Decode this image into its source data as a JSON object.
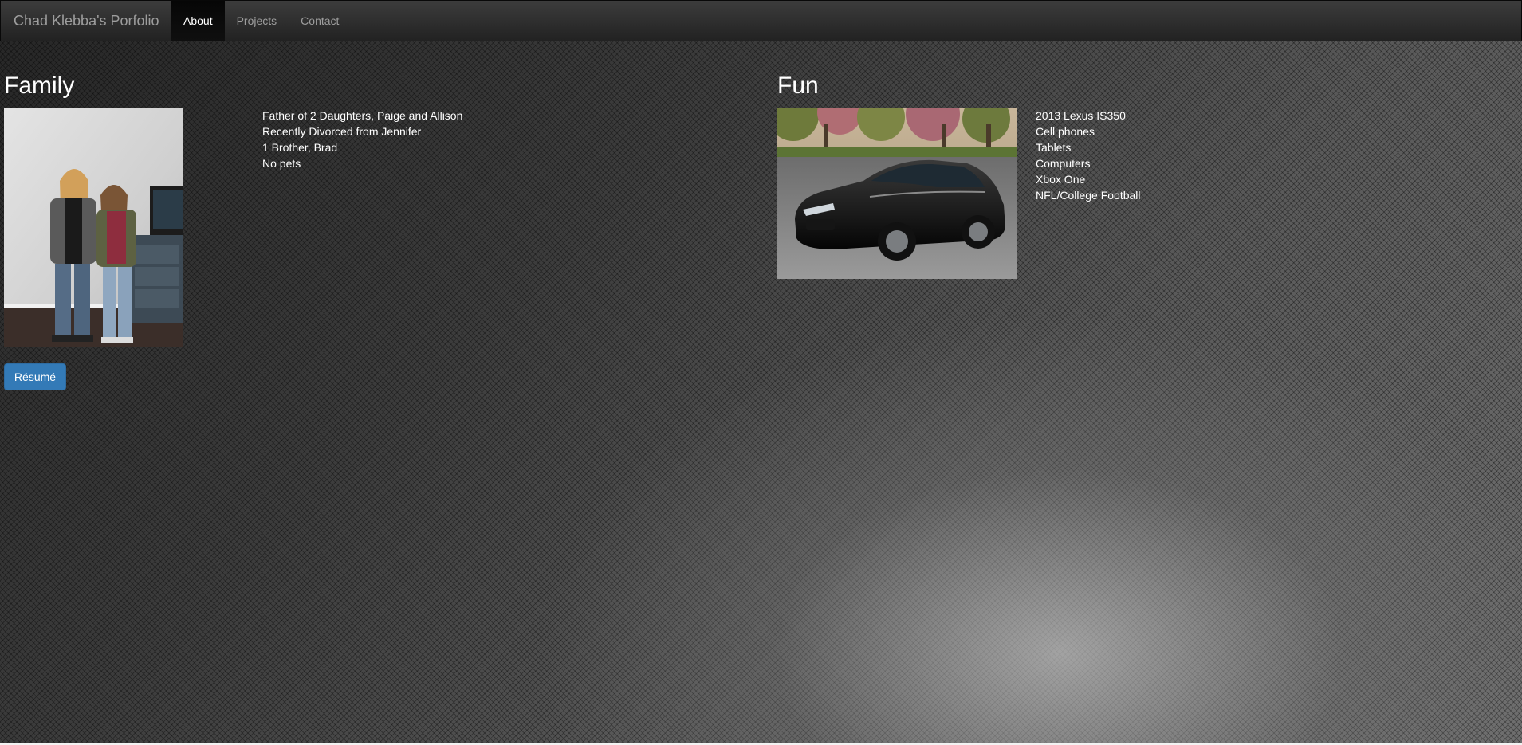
{
  "navbar": {
    "brand": "Chad Klebba's Porfolio",
    "items": [
      {
        "label": "About",
        "active": true
      },
      {
        "label": "Projects",
        "active": false
      },
      {
        "label": "Contact",
        "active": false
      }
    ]
  },
  "family": {
    "title": "Family",
    "image_alt": "Photo of two daughters standing in a living room",
    "items": [
      "Father of 2 Daughters, Paige and Allison",
      "Recently Divorced from Jennifer",
      "1 Brother, Brad",
      "No pets"
    ]
  },
  "fun": {
    "title": "Fun",
    "image_alt": "Photo of a black 2013 Lexus IS350",
    "items": [
      "2013 Lexus IS350",
      "Cell phones",
      "Tablets",
      "Computers",
      "Xbox One",
      "NFL/College Football"
    ]
  },
  "resume_button": {
    "label": "Résumé",
    "color": "#337ab7"
  }
}
